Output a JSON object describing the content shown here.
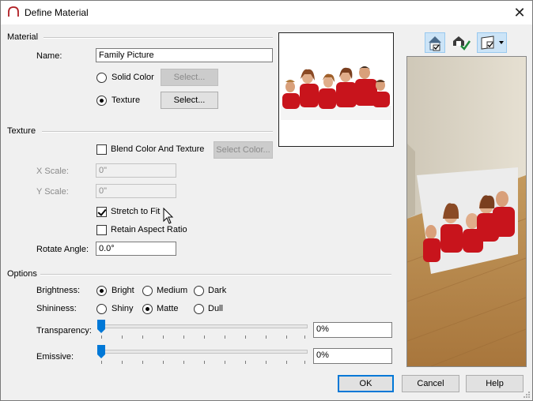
{
  "window": {
    "title": "Define Material",
    "close_symbol": "✕"
  },
  "material": {
    "section_label": "Material",
    "name_label": "Name:",
    "name_value": "Family Picture",
    "solid_color_label": "Solid Color",
    "solid_color_button": "Select...",
    "texture_label": "Texture",
    "texture_button": "Select...",
    "selected": "texture"
  },
  "texture": {
    "section_label": "Texture",
    "blend_label": "Blend Color And Texture",
    "blend_checked": false,
    "select_color_button": "Select Color...",
    "x_scale_label": "X Scale:",
    "x_scale_value": "0\"",
    "y_scale_label": "Y Scale:",
    "y_scale_value": "0\"",
    "stretch_label": "Stretch to Fit",
    "stretch_checked": true,
    "retain_label": "Retain Aspect Ratio",
    "retain_checked": false,
    "rotate_label": "Rotate Angle:",
    "rotate_value": "0.0°"
  },
  "options": {
    "section_label": "Options",
    "brightness_label": "Brightness:",
    "brightness_options": [
      "Bright",
      "Medium",
      "Dark"
    ],
    "brightness_selected": "Bright",
    "shininess_label": "Shininess:",
    "shininess_options": [
      "Shiny",
      "Matte",
      "Dull"
    ],
    "shininess_selected": "Matte",
    "transparency_label": "Transparency:",
    "transparency_value": "0%",
    "transparency_level": 0,
    "emissive_label": "Emissive:",
    "emissive_value": "0%",
    "emissive_level": 0
  },
  "toolbar": {
    "icons": [
      "view-room-icon",
      "check-material-icon",
      "preview-surface-dropdown-icon"
    ]
  },
  "buttons": {
    "ok": "OK",
    "cancel": "Cancel",
    "help": "Help"
  },
  "colors": {
    "accent": "#0078d7",
    "floor": "#b88a4e",
    "wall": "#d9d2c3",
    "shirt_red": "#c8141c"
  }
}
